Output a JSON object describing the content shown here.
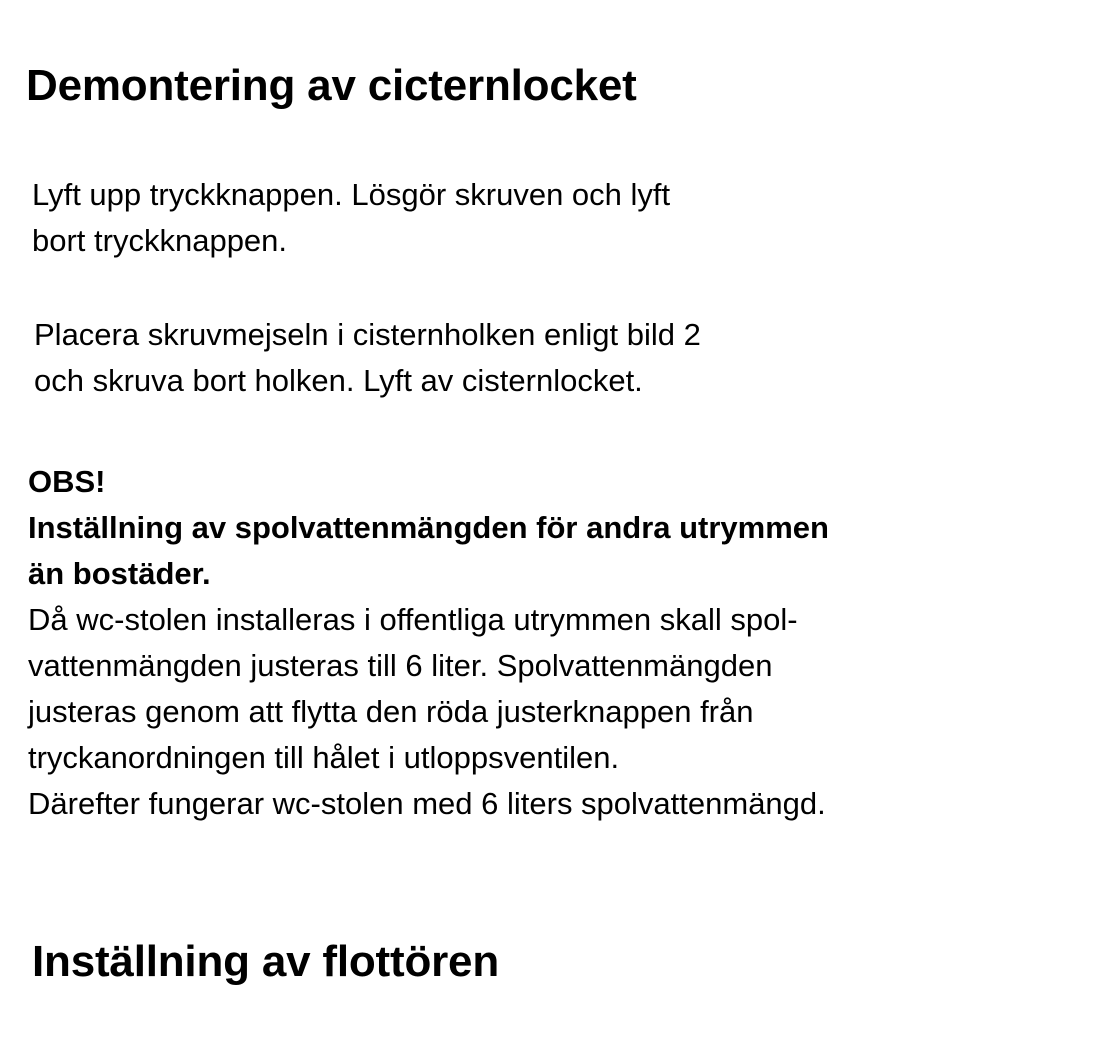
{
  "document": {
    "heading_1": "Demontering av cicternlocket",
    "paragraph_1": {
      "lines": [
        "Lyft upp tryckknappen. Lösgör skruven och lyft",
        "bort tryckknappen."
      ]
    },
    "paragraph_2": {
      "lines": [
        "Placera skruvmejseln i cisternholken enligt bild 2",
        "och skruva bort holken. Lyft av cisternlocket."
      ]
    },
    "notice": {
      "label": "OBS!",
      "subheading_lines": [
        "Inställning av spolvattenmängden för andra utrymmen",
        "än bostäder."
      ],
      "body_lines": [
        "Då wc-stolen installeras i offentliga utrymmen skall spol-",
        "vattenmängden justeras till 6 liter. Spolvattenmängden",
        "justeras genom att flytta den röda justerknappen från",
        "tryckanordningen till hålet i utloppsventilen.",
        "Därefter fungerar wc-stolen med 6 liters spolvattenmängd."
      ]
    },
    "heading_2": "Inställning av flottören"
  }
}
